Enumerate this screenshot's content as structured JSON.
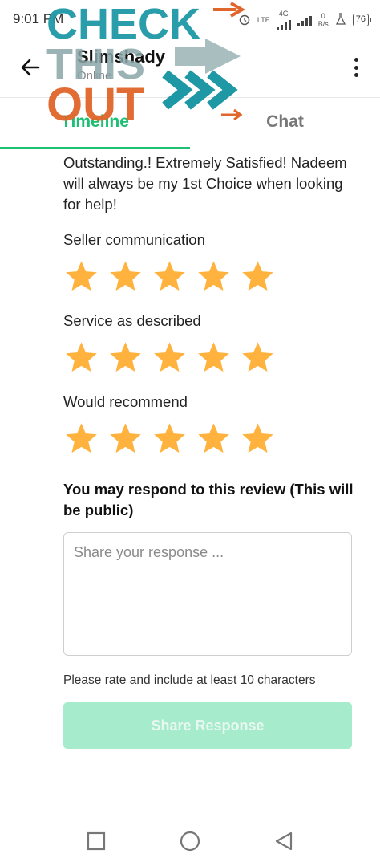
{
  "status_bar": {
    "time": "9:01 PM",
    "network_type": "4G",
    "lte_label": "LTE",
    "speed_value": "0",
    "speed_unit": "B/s",
    "battery": "76"
  },
  "header": {
    "contact_name": "Slimshady",
    "contact_status": "Online"
  },
  "tabs": [
    {
      "label": "Timeline",
      "active": true
    },
    {
      "label": "Chat",
      "active": false
    }
  ],
  "overlay": {
    "lines": [
      "CHECK",
      "THIS",
      "OUT"
    ]
  },
  "review": {
    "text": "Outstanding.! Extremely Satisfied! Nadeem will always be my 1st Choice when looking for help!",
    "ratings": [
      {
        "label": "Seller communication",
        "stars": 5,
        "max": 5
      },
      {
        "label": "Service as described",
        "stars": 5,
        "max": 5
      },
      {
        "label": "Would recommend",
        "stars": 5,
        "max": 5
      }
    ]
  },
  "response": {
    "title": "You may respond to this review (This will be public)",
    "placeholder": "Share your response ...",
    "value": "",
    "hint": "Please rate and include at least 10 characters",
    "button_label": "Share Response"
  },
  "colors": {
    "accent_green": "#1dbf73",
    "button_disabled": "#a6ebcb",
    "star": "#ffb33e",
    "overlay_teal": "#1f98a6",
    "overlay_orange": "#e0662b"
  },
  "icons": {
    "back": "arrow-left-icon",
    "menu": "more-vertical-icon",
    "star": "star-icon",
    "nav_recents": "square-icon",
    "nav_home": "circle-icon",
    "nav_back": "triangle-back-icon"
  }
}
